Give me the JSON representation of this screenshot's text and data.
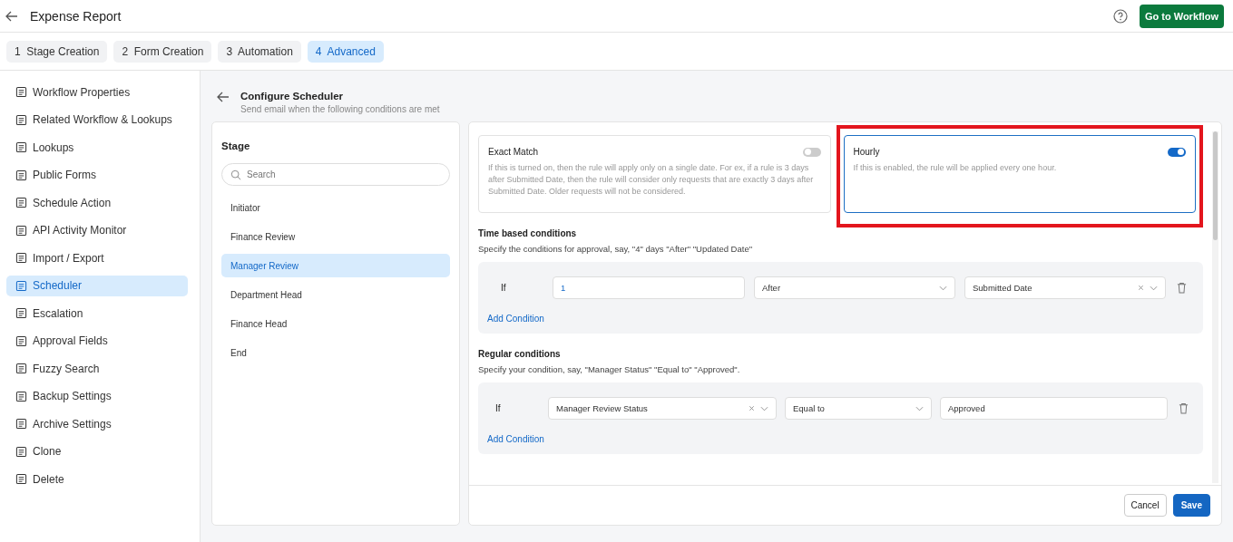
{
  "header": {
    "title": "Expense Report",
    "action": "Go to Workflow"
  },
  "steps": [
    {
      "number": "1",
      "label": "Stage Creation",
      "selected": false
    },
    {
      "number": "2",
      "label": "Form Creation",
      "selected": false
    },
    {
      "number": "3",
      "label": "Automation",
      "selected": false
    },
    {
      "number": "4",
      "label": "Advanced",
      "selected": true
    }
  ],
  "sidebar": {
    "items": [
      {
        "label": "Workflow Properties",
        "selected": false
      },
      {
        "label": "Related Workflow & Lookups",
        "selected": false
      },
      {
        "label": "Lookups",
        "selected": false
      },
      {
        "label": "Public Forms",
        "selected": false
      },
      {
        "label": "Schedule Action",
        "selected": false
      },
      {
        "label": "API Activity Monitor",
        "selected": false
      },
      {
        "label": "Import / Export",
        "selected": false
      },
      {
        "label": "Scheduler",
        "selected": true
      },
      {
        "label": "Escalation",
        "selected": false
      },
      {
        "label": "Approval Fields",
        "selected": false
      },
      {
        "label": "Fuzzy Search",
        "selected": false
      },
      {
        "label": "Backup Settings",
        "selected": false
      },
      {
        "label": "Archive Settings",
        "selected": false
      },
      {
        "label": "Clone",
        "selected": false
      },
      {
        "label": "Delete",
        "selected": false
      }
    ]
  },
  "scheduler": {
    "title": "Configure Scheduler",
    "subtitle": "Send email when the following conditions are met"
  },
  "stage_panel": {
    "title": "Stage",
    "search": {
      "placeholder": "Search"
    },
    "stages": [
      {
        "label": "Initiator",
        "selected": false
      },
      {
        "label": "Finance Review",
        "selected": false
      },
      {
        "label": "Manager Review",
        "selected": true
      },
      {
        "label": "Department Head",
        "selected": false
      },
      {
        "label": "Finance Head",
        "selected": false
      },
      {
        "label": "End",
        "selected": false
      }
    ]
  },
  "options": [
    {
      "title": "Exact Match",
      "description": "If this is turned on, then the rule will apply only on a single date. For ex, if a rule is 3 days after Submitted Date, then the rule will consider only requests that are exactly 3 days after Submitted Date. Older requests will not be considered.",
      "on": false,
      "highlighted": false
    },
    {
      "title": "Hourly",
      "description": "If this is enabled, the rule will be applied every one hour.",
      "on": true,
      "highlighted": true
    }
  ],
  "time_conditions": {
    "title": "Time based conditions",
    "hint": "Specify the conditions for approval, say, \"4\" days \"After\" \"Updated Date\"",
    "rows": [
      {
        "prefix": "If",
        "fields": [
          {
            "kind": "input",
            "value": "1"
          },
          {
            "kind": "select",
            "value": "After",
            "clearable": false
          },
          {
            "kind": "select",
            "value": "Submitted Date",
            "clearable": true
          }
        ]
      }
    ],
    "add": "Add Condition"
  },
  "regular_conditions": {
    "title": "Regular conditions",
    "hint": "Specify your condition, say, \"Manager Status\" \"Equal to\" \"Approved\".",
    "rows": [
      {
        "prefix": "If",
        "fields": [
          {
            "kind": "select",
            "value": "Manager Review Status",
            "clearable": true
          },
          {
            "kind": "select",
            "value": "Equal to",
            "clearable": false
          },
          {
            "kind": "input",
            "value": "Approved"
          }
        ]
      }
    ],
    "add": "Add Condition"
  },
  "footer": {
    "buttons": [
      {
        "label": "Cancel",
        "kind": "secondary"
      },
      {
        "label": "Save",
        "kind": "primary"
      }
    ]
  }
}
